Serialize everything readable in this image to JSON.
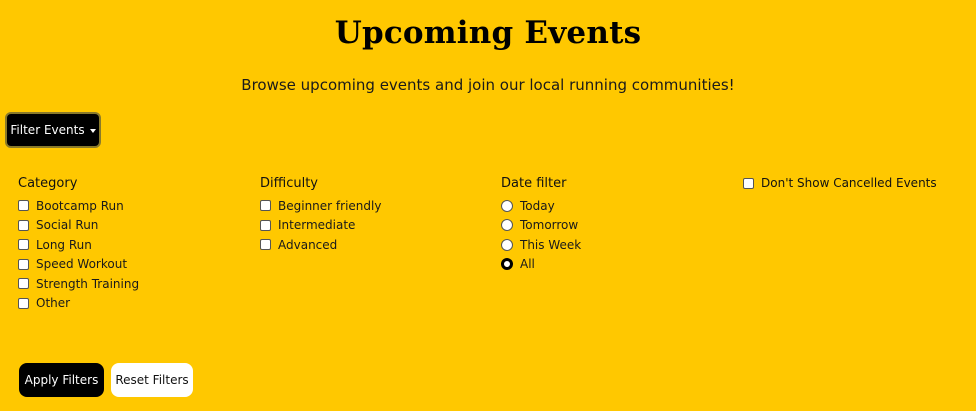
{
  "header": {
    "title": "Upcoming Events",
    "subtitle": "Browse upcoming events and join our local running communities!"
  },
  "filter_toggle": {
    "label": "Filter Events",
    "icon": "caret-down-icon"
  },
  "filters": {
    "category": {
      "title": "Category",
      "options": [
        {
          "label": "Bootcamp Run",
          "checked": false
        },
        {
          "label": "Social Run",
          "checked": false
        },
        {
          "label": "Long Run",
          "checked": false
        },
        {
          "label": "Speed Workout",
          "checked": false
        },
        {
          "label": "Strength Training",
          "checked": false
        },
        {
          "label": "Other",
          "checked": false
        }
      ]
    },
    "difficulty": {
      "title": "Difficulty",
      "options": [
        {
          "label": "Beginner friendly",
          "checked": false
        },
        {
          "label": "Intermediate",
          "checked": false
        },
        {
          "label": "Advanced",
          "checked": false
        }
      ]
    },
    "date_filter": {
      "title": "Date filter",
      "selected": "All",
      "options": [
        {
          "label": "Today"
        },
        {
          "label": "Tomorrow"
        },
        {
          "label": "This Week"
        },
        {
          "label": "All"
        }
      ]
    },
    "cancelled": {
      "label": "Don't Show Cancelled Events",
      "checked": false
    }
  },
  "actions": {
    "apply_label": "Apply Filters",
    "reset_label": "Reset Filters"
  },
  "colors": {
    "background": "#ffc800",
    "primary_button": "#000000",
    "secondary_button": "#ffffff"
  }
}
